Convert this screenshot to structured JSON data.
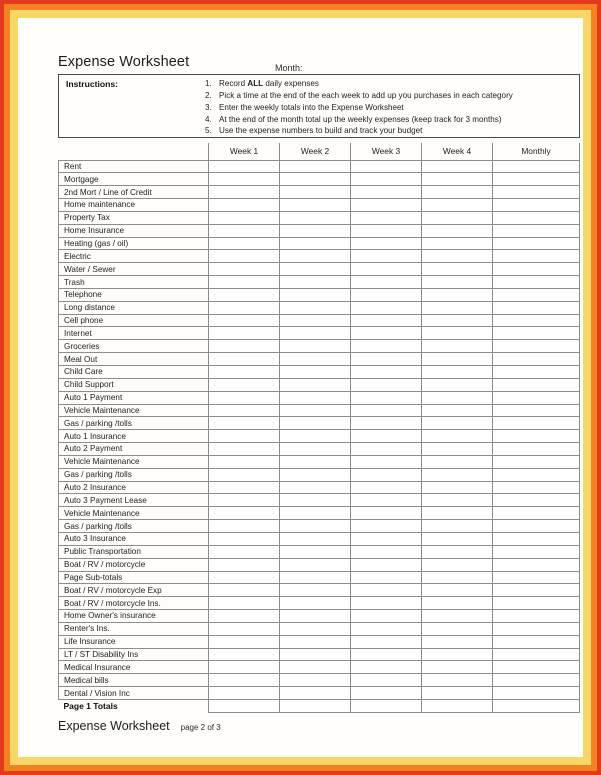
{
  "document": {
    "title": "Expense Worksheet",
    "month_label": "Month:"
  },
  "instructions": {
    "label": "Instructions:",
    "items": [
      {
        "num": "1.",
        "pre": "Record ",
        "bold": "ALL",
        "post": " daily expenses"
      },
      {
        "num": "2.",
        "pre": "Pick a time at the end of the each week to add up you purchases in each category",
        "bold": "",
        "post": ""
      },
      {
        "num": "3.",
        "pre": "Enter the weekly totals into the Expense Worksheet",
        "bold": "",
        "post": ""
      },
      {
        "num": "4.",
        "pre": "At the end of the month total up the weekly expenses (keep track for 3 months)",
        "bold": "",
        "post": ""
      },
      {
        "num": "5.",
        "pre": "Use the expense numbers to build and track your budget",
        "bold": "",
        "post": ""
      }
    ]
  },
  "table": {
    "columns": [
      "Week 1",
      "Week 2",
      "Week 3",
      "Week 4",
      "Monthly"
    ],
    "rows": [
      "Rent",
      "Mortgage",
      "2nd Mort / Line of Credit",
      "Home maintenance",
      "Property Tax",
      "Home Insurance",
      "Heating (gas / oil)",
      "Electric",
      "Water / Sewer",
      "Trash",
      "Telephone",
      "Long distance",
      "Cell phone",
      "Internet",
      "Groceries",
      "Meal Out",
      "Child Care",
      "Child Support",
      "Auto 1 Payment",
      "Vehicle Maintenance",
      "Gas / parking /tolls",
      "Auto 1 Insurance",
      "Auto 2 Payment",
      "Vehicle Maintenance",
      "Gas / parking /tolls",
      "Auto 2 Insurance",
      "Auto 3 Payment Lease",
      "Vehicle Maintenance",
      "Gas / parking /tolls",
      "Auto 3 Insurance",
      "Public Transportation",
      "Boat / RV / motorcycle",
      "Page Sub-totals",
      "Boat / RV / motorcycle Exp",
      "Boat / RV / motorcycle Ins.",
      "Home Owner's insurance",
      "Renter's Ins.",
      "Life Insurance",
      "LT / ST Disability Ins",
      "Medical Insurance",
      "Medical bills",
      "Dental / Vision Inc"
    ],
    "totals_row_label": "Page 1 Totals"
  },
  "footer": {
    "title": "Expense Worksheet",
    "page": "page 2 of 3"
  },
  "colors": {
    "border_outer": "#e23a1b",
    "border_mid": "#f58220",
    "border_inner": "#f8d76a",
    "grid": "#8d8d8d",
    "text": "#222222"
  }
}
